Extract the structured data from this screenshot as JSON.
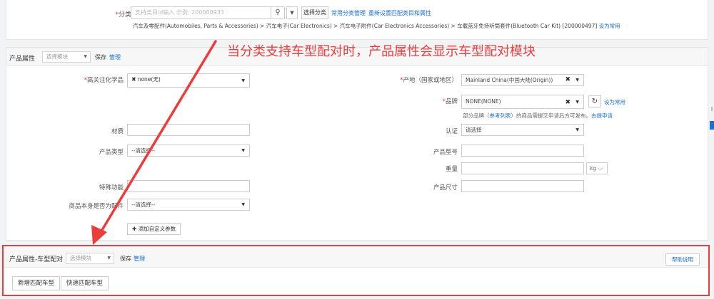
{
  "category": {
    "label": "分类",
    "input_placeholder": "支持类目id输入 示例: 200000933",
    "select_button": "选择分类",
    "links": [
      "常用分类管理",
      "重新设置匹配类目和属性"
    ],
    "path": "汽车及零配件(Automobiles, Parts & Accessories) > 汽车电子(Car Electronics) > 汽车电子附件(Car Electronics Accessories) > 车载蓝牙免持听筒套件(Bluetooth Car Kit) [200000497]",
    "path_link": "设为常用"
  },
  "annotation": "当分类支持车型配对时，产品属性会显示车型配对模块",
  "attributes": {
    "title": "产品属性",
    "template_placeholder": "选择模块",
    "save": "保存",
    "manage": "管理",
    "fields": {
      "hazard": {
        "label": "高关注化学品",
        "value": "none(无)"
      },
      "origin": {
        "label": "产地（国家或地区）",
        "value": "Mainland China(中国大陆(Origin))"
      },
      "brand": {
        "label": "品牌",
        "value": "NONE(NONE)",
        "link": "设为常用",
        "note_prefix": "部分品牌（",
        "note_link1": "参考列表",
        "note_mid": "）的商品需提交申请后方可发布。",
        "note_link2": "去提申请"
      },
      "material": {
        "label": "材质"
      },
      "certification": {
        "label": "认证",
        "value": "请选择"
      },
      "product_type": {
        "label": "产品类型",
        "value": "--请选择--"
      },
      "model": {
        "label": "产品型号"
      },
      "weight": {
        "label": "重量",
        "unit": "kg"
      },
      "special": {
        "label": "特殊功能"
      },
      "size": {
        "label": "产品尺寸"
      },
      "is_accessory": {
        "label": "商品本身是否为配件",
        "value": "--请选择--"
      }
    },
    "add_param": "添加自定义参数"
  },
  "vehicle": {
    "title": "产品属性-车型配对",
    "template_placeholder": "选择模块",
    "save": "保存",
    "manage": "管理",
    "help": "帮助说明",
    "add_button": "新增匹配车型",
    "quick_button": "快速匹配车型"
  },
  "colors": {
    "accent_red": "#ee3b3b",
    "link_blue": "#1a6fd8"
  }
}
